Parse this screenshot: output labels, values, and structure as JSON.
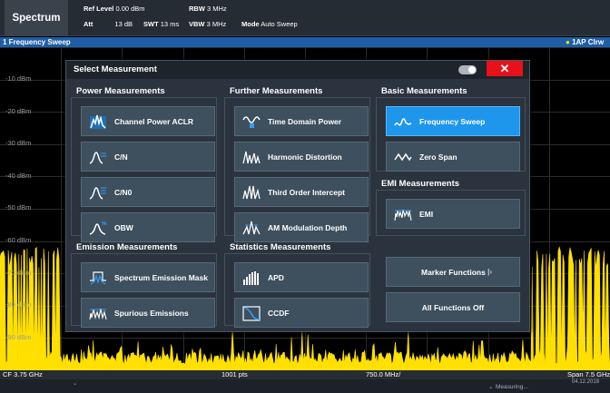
{
  "header": {
    "app_title": "Spectrum",
    "ref_level_label": "Ref Level",
    "ref_level_value": "0.00 dBm",
    "att_label": "Att",
    "att_value": "13 dB",
    "swt_label": "SWT",
    "swt_value": "13 ms",
    "rbw_label": "RBW",
    "rbw_value": "3 MHz",
    "vbw_label": "VBW",
    "vbw_value": "3 MHz",
    "mode_label": "Mode",
    "mode_value": "Auto Sweep"
  },
  "window": {
    "title": "1 Frequency Sweep",
    "trace_info": "1AP Clrw"
  },
  "plot": {
    "y_labels": [
      "-10 dBm",
      "-20 dBm",
      "-30 dBm",
      "-40 dBm",
      "-50 dBm",
      "-60 dBm",
      "-70 dBm",
      "-80 dBm",
      "-90 dBm"
    ],
    "trace_color": "#ffe000"
  },
  "xbar": {
    "cf": "CF 3.75 GHz",
    "points": "1001 pts",
    "per_div": "750.0 MHz/",
    "span": "Span 7.5 GHz"
  },
  "status": {
    "state": "Measuring...",
    "date": "04.12.2018"
  },
  "dialog": {
    "title": "Select Measurement",
    "close_color": "#e8101a",
    "selected_color": "#1e96ec",
    "sections": {
      "power": "Power Measurements",
      "further": "Further Measurements",
      "basic": "Basic Measurements",
      "emi": "EMI Measurements",
      "emission": "Emission Measurements",
      "statistics": "Statistics Measurements"
    },
    "power": [
      {
        "label": "Channel Power ACLR",
        "icon": "aclr-icon"
      },
      {
        "label": "C/N",
        "icon": "cn-icon"
      },
      {
        "label": "C/N0",
        "icon": "cn0-icon"
      },
      {
        "label": "OBW",
        "icon": "obw-icon"
      }
    ],
    "further": [
      {
        "label": "Time Domain Power",
        "icon": "time-domain-icon"
      },
      {
        "label": "Harmonic Distortion",
        "icon": "harmonic-icon"
      },
      {
        "label": "Third Order Intercept",
        "icon": "toi-icon"
      },
      {
        "label": "AM Modulation Depth",
        "icon": "am-depth-icon"
      }
    ],
    "basic": [
      {
        "label": "Frequency Sweep",
        "icon": "freq-sweep-icon",
        "selected": true
      },
      {
        "label": "Zero Span",
        "icon": "zero-span-icon"
      }
    ],
    "emi": [
      {
        "label": "EMI",
        "icon": "emi-icon"
      }
    ],
    "emission": [
      {
        "label": "Spectrum Emission Mask",
        "icon": "sem-icon"
      },
      {
        "label": "Spurious Emissions",
        "icon": "spurious-icon"
      }
    ],
    "statistics": [
      {
        "label": "APD",
        "icon": "apd-icon"
      },
      {
        "label": "CCDF",
        "icon": "ccdf-icon"
      }
    ],
    "marker_functions": "Marker Functions",
    "all_functions_off": "All Functions Off"
  }
}
